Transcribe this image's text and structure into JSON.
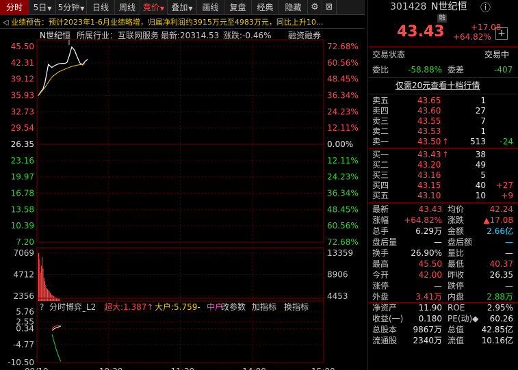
{
  "toolbar": {
    "tabs": [
      "分时",
      "5日",
      "5分钟",
      "日线",
      "周线",
      "竞价",
      "叠加",
      "画线",
      "复盘",
      "经典",
      "隐藏"
    ],
    "active": "分时",
    "dropdown_tabs": [
      "5日",
      "5分钟",
      "竞价",
      "叠加"
    ],
    "icons": [
      "settings-icon",
      "close-icon"
    ]
  },
  "banner": {
    "prefix": "◁",
    "text": "业绩预告：预计2023年1-6月业绩略增，归属净利润约3915万元至4983万元，同比上升10..."
  },
  "chart": {
    "header": {
      "name": "N世纪恒",
      "industry": "所属行业：互联网服务",
      "latest": "最新:20314.53",
      "change": "涨跌:-0.46%",
      "margin": "融资融券"
    },
    "price_labels_left": [
      "45.50",
      "42.31",
      "39.12",
      "35.93",
      "32.73",
      "29.54",
      "26.35",
      "23.16",
      "19.97",
      "16.78",
      "13.58",
      "10.39",
      "7.20"
    ],
    "pct_labels_right": [
      "72.68%",
      "60.56%",
      "48.45%",
      "36.34%",
      "24.23%",
      "12.11%",
      "0.00%",
      "12.11%",
      "24.23%",
      "36.34%",
      "48.45%",
      "60.56%",
      "72.68%"
    ],
    "volume_left": [
      "7069",
      "4712",
      "2356"
    ],
    "volume_right": [
      "13359",
      "8906",
      "4453"
    ],
    "indicator": {
      "label_q": "?",
      "name": "分时博弈_L2",
      "big": "超大:1.387↑",
      "large": "大户:5.759-",
      "mid": "中户",
      "param": "改参数",
      "add": "加指标",
      "switch": "换指标"
    },
    "indicator_axis": [
      "5.76",
      "2.55",
      "0.34",
      "-4.77",
      "-10.50"
    ],
    "time_axis": [
      "09/19",
      "10:30",
      "11:30",
      "14:00",
      "15:00"
    ]
  },
  "chart_data": {
    "type": "line",
    "title": "N世纪恒",
    "prev_close": 26.35,
    "ylim": [
      7.2,
      45.5
    ],
    "price": [
      [
        0,
        35.9
      ],
      [
        0.3,
        36.5
      ],
      [
        0.7,
        37.2
      ],
      [
        1,
        38.5
      ],
      [
        1.5,
        42.0
      ],
      [
        2,
        41.4
      ],
      [
        2.5,
        41.8
      ],
      [
        3,
        42.1
      ],
      [
        3.5,
        42.2
      ],
      [
        4,
        42.2
      ],
      [
        4.3,
        42.4
      ],
      [
        4.6,
        43.6
      ],
      [
        5,
        45.4
      ],
      [
        5.4,
        44.8
      ],
      [
        5.8,
        43.5
      ],
      [
        6.2,
        42.3
      ],
      [
        6.6,
        41.9
      ],
      [
        7,
        42.6
      ],
      [
        7.4,
        43.0
      ]
    ],
    "avg_price": [
      [
        0,
        35.9
      ],
      [
        1,
        37.5
      ],
      [
        2,
        39.5
      ],
      [
        3,
        40.5
      ],
      [
        4,
        41.1
      ],
      [
        5,
        41.6
      ],
      [
        6,
        41.9
      ],
      [
        7,
        42.1
      ]
    ],
    "volume": [
      [
        0,
        7069
      ],
      [
        1,
        6200
      ],
      [
        2,
        4200
      ],
      [
        3,
        5200
      ],
      [
        4,
        6500
      ],
      [
        5,
        4800
      ],
      [
        6,
        3400
      ],
      [
        7,
        2900
      ],
      [
        8,
        2300
      ],
      [
        9,
        1900
      ],
      [
        10,
        1700
      ],
      [
        11,
        1600
      ],
      [
        12,
        1400
      ],
      [
        13,
        1200
      ],
      [
        14,
        1000
      ],
      [
        15,
        900
      ],
      [
        16,
        800
      ],
      [
        17,
        700
      ],
      [
        18,
        600
      ],
      [
        19,
        550
      ],
      [
        20,
        500
      ],
      [
        21,
        450
      ],
      [
        22,
        400
      ],
      [
        23,
        350
      ]
    ],
    "indicator_ylim": [
      -10.5,
      5.76
    ],
    "indicator_white": [
      [
        0,
        -0.2
      ],
      [
        2,
        0.3
      ],
      [
        4,
        0.7
      ],
      [
        6,
        0.9
      ],
      [
        8,
        1.1
      ]
    ],
    "indicator_red": [
      [
        0,
        0.34
      ],
      [
        2,
        1.0
      ],
      [
        4,
        1.3
      ],
      [
        6,
        1.4
      ],
      [
        8,
        1.5
      ]
    ],
    "indicator_green": [
      [
        0,
        -1.5
      ],
      [
        2,
        -4.0
      ],
      [
        4,
        -6.5
      ],
      [
        6,
        -8.5
      ],
      [
        8,
        -10.2
      ]
    ]
  },
  "quote": {
    "code": "301428",
    "name": "N世纪恒",
    "rong": "融",
    "info_icon": "info-icon",
    "price": "43.43",
    "change": "+17.08",
    "change_pct": "+64.82%",
    "add_icon": "plus-icon",
    "status_label": "交易状态",
    "status_value": "交易中",
    "weibi_label": "委比",
    "weibi": "-58.88%",
    "weicha_label": "委差",
    "weicha": "-407",
    "promo": "仅需20元查看十档行情",
    "asks": [
      {
        "label": "卖五",
        "price": "43.65",
        "vol": "1",
        "delta": ""
      },
      {
        "label": "卖四",
        "price": "43.60",
        "vol": "27",
        "delta": ""
      },
      {
        "label": "卖三",
        "price": "43.55",
        "vol": "7",
        "delta": ""
      },
      {
        "label": "卖二",
        "price": "43.53",
        "vol": "1",
        "delta": ""
      },
      {
        "label": "卖一",
        "price": "43.50",
        "vol": "513",
        "delta": "-24",
        "up": "↑"
      }
    ],
    "bids": [
      {
        "label": "买一",
        "price": "43.43",
        "vol": "38",
        "delta": "",
        "up": "↑"
      },
      {
        "label": "买二",
        "price": "43.20",
        "vol": "49",
        "delta": ""
      },
      {
        "label": "买三",
        "price": "43.16",
        "vol": "5",
        "delta": ""
      },
      {
        "label": "买四",
        "price": "43.15",
        "vol": "40",
        "delta": "+27"
      },
      {
        "label": "买五",
        "price": "43.10",
        "vol": "10",
        "delta": "+9"
      }
    ],
    "stats": [
      {
        "l1": "最新",
        "v1": "43.43",
        "c1": "red",
        "l2": "均价",
        "v2": "42.24",
        "c2": "red"
      },
      {
        "l1": "涨幅",
        "v1": "+64.82%",
        "c1": "red",
        "l2": "涨跌",
        "v2": "▲17.08",
        "c2": "red"
      },
      {
        "l1": "总手",
        "v1": "6.29万",
        "c1": "white",
        "l2": "金额",
        "v2": "2.66亿",
        "c2": "cyan"
      },
      {
        "l1": "盘后量",
        "v1": "—",
        "c1": "white",
        "l2": "盘后额",
        "v2": "—",
        "c2": "cyan"
      },
      {
        "l1": "换手",
        "v1": "26.90%",
        "c1": "white",
        "l2": "量比",
        "v2": "—",
        "c2": "white"
      },
      {
        "l1": "最高",
        "v1": "45.50",
        "c1": "red",
        "l2": "最低",
        "v2": "40.37",
        "c2": "red"
      },
      {
        "l1": "今开",
        "v1": "42.00",
        "c1": "red",
        "l2": "昨收",
        "v2": "26.35",
        "c2": "white"
      },
      {
        "l1": "涨停",
        "v1": "—",
        "c1": "white",
        "l2": "跌停",
        "v2": "—",
        "c2": "white"
      },
      {
        "l1": "外盘",
        "v1": "3.41万",
        "c1": "red",
        "l2": "内盘",
        "v2": "2.88万",
        "c2": "green"
      },
      {
        "l1": "净资产",
        "v1": "11.90",
        "c1": "white",
        "l2": "ROE",
        "v2": "2.95%",
        "c2": "white"
      },
      {
        "l1": "收益(一)",
        "v1": "0.180",
        "c1": "white",
        "l2": "PE(动)◆",
        "v2": "60.26",
        "c2": "white"
      },
      {
        "l1": "总股本",
        "v1": "9867万",
        "c1": "white",
        "l2": "总值",
        "v2": "42.85亿",
        "c2": "white"
      },
      {
        "l1": "流通股",
        "v1": "2340万",
        "c1": "white",
        "l2": "流值",
        "v2": "10.16亿",
        "c2": "white"
      }
    ]
  },
  "colors": {
    "up": "#ff4a4a",
    "down": "#2fd02f",
    "price_line": "#ffffff",
    "avg_line": "#e8c81a",
    "accent": "#7a0000"
  }
}
